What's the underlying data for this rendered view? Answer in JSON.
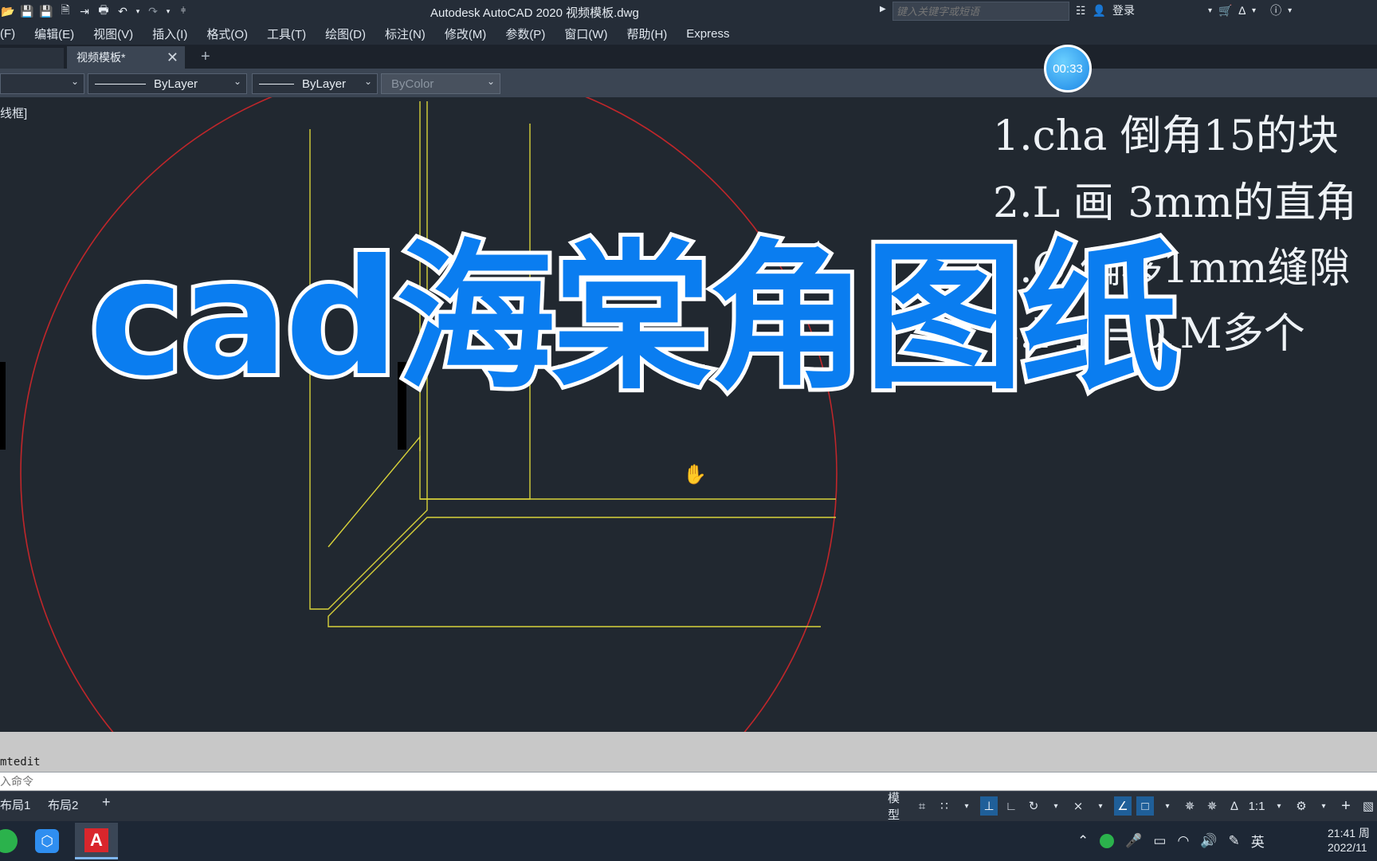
{
  "titlebar": {
    "app_title": "Autodesk AutoCAD 2020    视频模板.dwg",
    "search_placeholder": "键入关键字或短语",
    "login_label": "登录"
  },
  "menubar": {
    "items": [
      "(F)",
      "编辑(E)",
      "视图(V)",
      "插入(I)",
      "格式(O)",
      "工具(T)",
      "绘图(D)",
      "标注(N)",
      "修改(M)",
      "参数(P)",
      "窗口(W)",
      "帮助(H)",
      "Express"
    ]
  },
  "tabs": {
    "document": "视频模板*"
  },
  "properties": {
    "linetype": "ByLayer",
    "lineweight": "ByLayer",
    "plotstyle": "ByColor"
  },
  "viewport": {
    "label": "线框]"
  },
  "timer": "00:33",
  "overlay": {
    "title": "cad海棠角图纸"
  },
  "notes": [
    "1.cha 倒角15的块",
    "2.L 画 3mm的直角",
    "3.O 偏移1mm缝隙",
    "4.F R=0 M多个"
  ],
  "command": {
    "history": "mtedit",
    "placeholder": "入命令"
  },
  "layout_tabs": [
    "布局1",
    "布局2"
  ],
  "statusbar": {
    "model_label": "模型",
    "scale": "1:1"
  },
  "taskbar": {
    "lang": "英",
    "time": "21:41 周",
    "date": "2022/11"
  },
  "colors": {
    "drawing_bg": "#212830",
    "circle": "#c0262a",
    "geometry": "#d8d23a",
    "overlay_fill": "#0a7df0"
  }
}
